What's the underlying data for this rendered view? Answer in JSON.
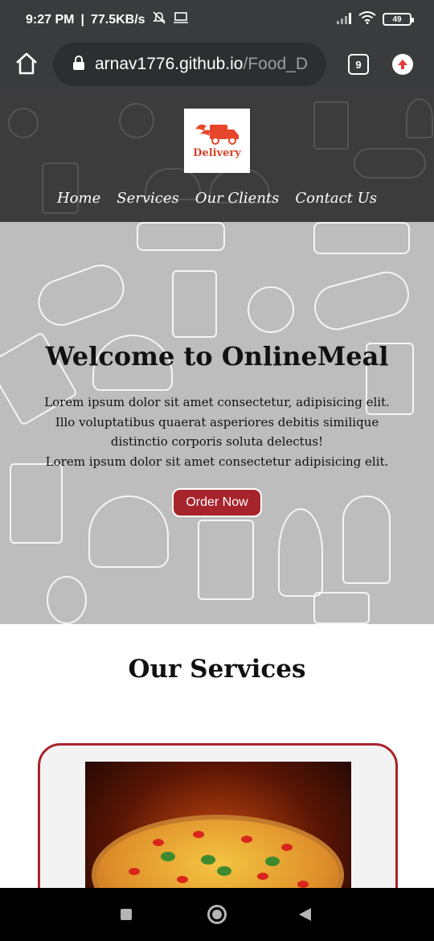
{
  "status_bar": {
    "time": "9:27 PM",
    "speed": "77.5KB/s",
    "battery": "49"
  },
  "browser": {
    "url_host": "arnav1776.github.io",
    "url_path": "/Food_D",
    "tab_count": "9"
  },
  "header": {
    "logo_text": "Delivery",
    "nav": [
      {
        "label": "Home"
      },
      {
        "label": "Services"
      },
      {
        "label": "Our Clients"
      },
      {
        "label": "Contact Us"
      }
    ]
  },
  "hero": {
    "title": "Welcome to OnlineMeal",
    "line1": "Lorem ipsum dolor sit amet consectetur, adipisicing elit.",
    "line2": "Illo voluptatibus quaerat asperiores debitis similique",
    "line3": "distinctio corporis soluta delectus!",
    "line4": "Lorem ipsum dolor sit amet consectetur adipisicing elit.",
    "button_label": "Order Now"
  },
  "services": {
    "title": "Our Services"
  },
  "colors": {
    "accent": "#a8242c",
    "header_bg": "#3c3c3c",
    "hero_bg": "#bdbdbd"
  }
}
